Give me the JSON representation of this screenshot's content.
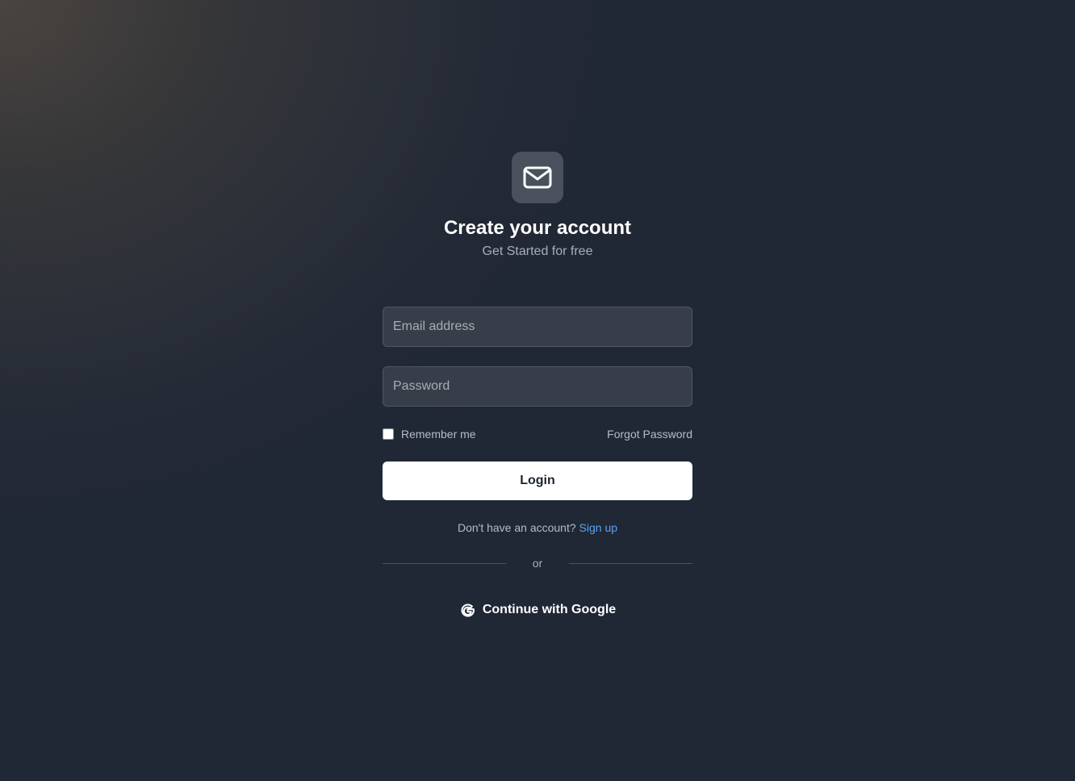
{
  "header": {
    "logo_icon": "mail-icon",
    "title": "Create your account",
    "subtitle": "Get Started for free"
  },
  "form": {
    "email_placeholder": "Email address",
    "email_value": "",
    "password_placeholder": "Password",
    "password_value": "",
    "remember_label": "Remember me",
    "remember_checked": false,
    "forgot_label": "Forgot Password",
    "login_label": "Login"
  },
  "signup": {
    "prompt": "Don't have an account?",
    "link_label": "Sign up"
  },
  "divider": {
    "label": "or"
  },
  "social": {
    "google_icon": "google-icon",
    "google_label": "Continue with Google"
  },
  "colors": {
    "accent_link": "#5aa6f5",
    "button_bg": "#ffffff",
    "input_bg": "#373e49"
  }
}
